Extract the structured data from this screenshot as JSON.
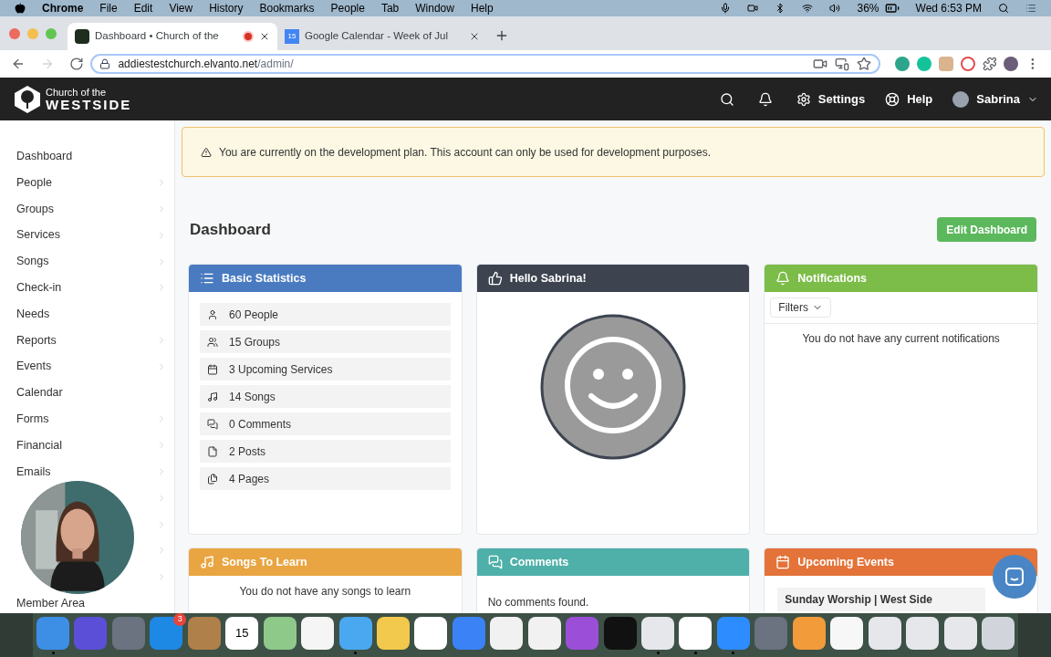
{
  "menu_bar": {
    "app": "Chrome",
    "items": [
      "File",
      "Edit",
      "View",
      "History",
      "Bookmarks",
      "People",
      "Tab",
      "Window",
      "Help"
    ],
    "battery": "36%",
    "clock": "Wed 6:53 PM"
  },
  "tabs": [
    {
      "title": "Dashboard • Church of the",
      "selected": true,
      "kind": "site",
      "recording": true
    },
    {
      "title": "Google Calendar - Week of Jul",
      "selected": false,
      "kind": "calendar",
      "favicon": "15",
      "recording": false
    }
  ],
  "address": {
    "host": "addiestestchurch.elvanto.net",
    "path": "/admin/"
  },
  "header": {
    "logo_top": "Church of the",
    "logo_bottom": "WESTSIDE",
    "settings": "Settings",
    "help": "Help",
    "user": "Sabrina"
  },
  "sidebar": {
    "items": [
      {
        "label": "Dashboard",
        "has_submenu": false
      },
      {
        "label": "People",
        "has_submenu": true
      },
      {
        "label": "Groups",
        "has_submenu": true
      },
      {
        "label": "Services",
        "has_submenu": true
      },
      {
        "label": "Songs",
        "has_submenu": true
      },
      {
        "label": "Check-in",
        "has_submenu": true
      },
      {
        "label": "Needs",
        "has_submenu": false
      },
      {
        "label": "Reports",
        "has_submenu": true
      },
      {
        "label": "Events",
        "has_submenu": true
      },
      {
        "label": "Calendar",
        "has_submenu": false
      },
      {
        "label": "Forms",
        "has_submenu": true
      },
      {
        "label": "Financial",
        "has_submenu": true
      },
      {
        "label": "Emails",
        "has_submenu": true
      },
      {
        "has_submenu": true
      },
      {
        "has_submenu": true
      },
      {
        "has_submenu": true
      },
      {
        "has_submenu": true
      },
      {
        "label": "Member Area",
        "has_submenu": false
      }
    ]
  },
  "alert": "You are currently on the development plan. This account can only be used for development purposes.",
  "page_title": "Dashboard",
  "edit_button": "Edit Dashboard",
  "cards": [
    {
      "title": "Basic Statistics",
      "color": "#4a7bc1",
      "kind": "stats",
      "items": [
        {
          "kind": "person",
          "label": "60 People"
        },
        {
          "kind": "people",
          "label": "15 Groups"
        },
        {
          "kind": "calendar",
          "label": "3 Upcoming Services"
        },
        {
          "kind": "music",
          "label": "14 Songs"
        },
        {
          "kind": "comments",
          "label": "0 Comments"
        },
        {
          "kind": "file",
          "label": "2 Posts"
        },
        {
          "kind": "pages",
          "label": "4 Pages"
        }
      ]
    },
    {
      "title": "Hello Sabrina!",
      "color": "#3d4450",
      "kind": "avatar"
    },
    {
      "title": "Notifications",
      "color": "#7cbc48",
      "kind": "notifications",
      "filter": "Filters",
      "message": "You do not have any current notifications"
    },
    {
      "title": "Songs To Learn",
      "color": "#e9a541",
      "kind": "message",
      "message": "You do not have any songs to learn"
    },
    {
      "title": "Comments",
      "color": "#4fb0a9",
      "kind": "text",
      "message": "No comments found."
    },
    {
      "title": "Upcoming Events",
      "color": "#e37339",
      "kind": "event",
      "event": "Sunday Worship | West Side"
    }
  ],
  "dock": [
    {
      "color": "#3d8fe6",
      "running": true
    },
    {
      "color": "#5b4fd8",
      "running": false
    },
    {
      "color": "#6b7280",
      "running": false
    },
    {
      "color": "#1e88e5",
      "running": false,
      "badge": "3"
    },
    {
      "color": "#b0804a",
      "running": false
    },
    {
      "color": "#ffffff",
      "running": false,
      "text": "15"
    },
    {
      "color": "#8fc98a",
      "running": false
    },
    {
      "color": "#f5f5f5",
      "running": false
    },
    {
      "color": "#4aa8f0",
      "running": true
    },
    {
      "color": "#f2c94c",
      "running": false
    },
    {
      "color": "#ffffff",
      "running": false
    },
    {
      "color": "#3b82f6",
      "running": false
    },
    {
      "color": "#f1f1f1",
      "running": false
    },
    {
      "color": "#f1f1f1",
      "running": false
    },
    {
      "color": "#9b4fd8",
      "running": false
    },
    {
      "color": "#111111",
      "running": false
    },
    {
      "color": "#e5e7eb",
      "running": true
    },
    {
      "color": "#ffffff",
      "running": true
    },
    {
      "color": "#2d8cff",
      "running": true
    },
    {
      "color": "#6b7280",
      "running": false
    },
    {
      "color": "#f29b3a",
      "running": false
    },
    {
      "color": "#f7f7f7",
      "running": false
    },
    {
      "color": "#e5e7eb",
      "running": false
    },
    {
      "color": "#e5e7eb",
      "running": false
    },
    {
      "color": "#e5e7eb",
      "running": false
    },
    {
      "color": "#d1d5db",
      "running": false
    }
  ]
}
